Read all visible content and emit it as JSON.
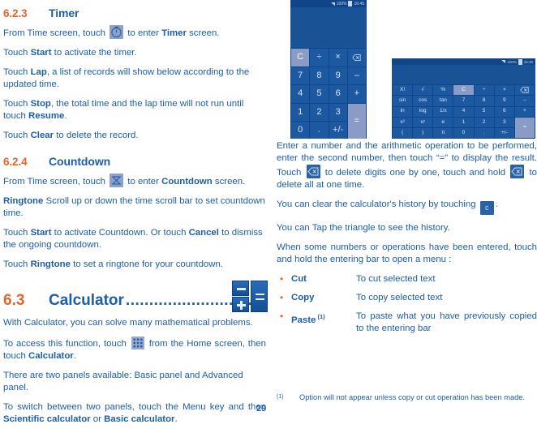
{
  "document": {
    "page_number": "29"
  },
  "sections": {
    "timer": {
      "number": "6.2.3",
      "title": "Timer",
      "paragraphs": [
        {
          "parts": [
            {
              "t": "text",
              "v": "From Time screen, touch "
            },
            {
              "t": "icon",
              "v": "timer-icon"
            },
            {
              "t": "text",
              "v": " to enter "
            },
            {
              "t": "bold",
              "v": "Timer"
            },
            {
              "t": "text",
              "v": " screen."
            }
          ]
        },
        {
          "parts": [
            {
              "t": "text",
              "v": "Touch "
            },
            {
              "t": "bold",
              "v": "Start"
            },
            {
              "t": "text",
              "v": " to activate the timer."
            }
          ]
        },
        {
          "parts": [
            {
              "t": "text",
              "v": "Touch "
            },
            {
              "t": "bold",
              "v": "Lap"
            },
            {
              "t": "text",
              "v": ", a list of records will show below according to the updated time."
            }
          ]
        },
        {
          "parts": [
            {
              "t": "text",
              "v": "Touch "
            },
            {
              "t": "bold",
              "v": "Stop"
            },
            {
              "t": "text",
              "v": ", the total time and the lap time will not run until touch "
            },
            {
              "t": "bold",
              "v": "Resume"
            },
            {
              "t": "text",
              "v": "."
            }
          ]
        },
        {
          "parts": [
            {
              "t": "text",
              "v": "Touch "
            },
            {
              "t": "bold",
              "v": "Clear"
            },
            {
              "t": "text",
              "v": " to delete the record."
            }
          ]
        }
      ]
    },
    "countdown": {
      "number": "6.2.4",
      "title": "Countdown",
      "paragraphs": [
        {
          "parts": [
            {
              "t": "text",
              "v": "From Time screen, touch "
            },
            {
              "t": "icon",
              "v": "hourglass-icon"
            },
            {
              "t": "text",
              "v": " to enter "
            },
            {
              "t": "bold",
              "v": "Countdown"
            },
            {
              "t": "text",
              "v": " screen."
            }
          ]
        },
        {
          "parts": [
            {
              "t": "bold",
              "v": "Ringtone"
            },
            {
              "t": "text",
              "v": " Scroll up or down the time scroll bar to set countdown time."
            }
          ]
        },
        {
          "parts": [
            {
              "t": "text",
              "v": "Touch "
            },
            {
              "t": "bold",
              "v": "Start"
            },
            {
              "t": "text",
              "v": " to activate Countdown. Or touch "
            },
            {
              "t": "bold",
              "v": "Cancel"
            },
            {
              "t": "text",
              "v": " to dismiss the ongoing countdown."
            }
          ]
        },
        {
          "parts": [
            {
              "t": "text",
              "v": "Touch "
            },
            {
              "t": "bold",
              "v": "Ringtone"
            },
            {
              "t": "text",
              "v": " to set a ringtone for your countdown."
            }
          ]
        }
      ]
    },
    "calculator": {
      "number": "6.3",
      "title": "Calculator",
      "dots": "...........................................",
      "paragraphs": [
        {
          "parts": [
            {
              "t": "text",
              "v": "With Calculator, you can solve many mathematical problems."
            }
          ]
        },
        {
          "justify": true,
          "parts": [
            {
              "t": "text",
              "v": "To access this function, touch "
            },
            {
              "t": "icon",
              "v": "apps-grid-icon"
            },
            {
              "t": "text",
              "v": " from the Home screen, then touch "
            },
            {
              "t": "bold",
              "v": "Calculator"
            },
            {
              "t": "text",
              "v": "."
            }
          ]
        },
        {
          "parts": [
            {
              "t": "text",
              "v": "There are two panels available: Basic panel and Advanced panel."
            }
          ]
        },
        {
          "justify": true,
          "parts": [
            {
              "t": "text",
              "v": "To switch between two panels, touch the Menu key and then "
            },
            {
              "t": "bold",
              "v": "Scientific calculator"
            },
            {
              "t": "text",
              "v": " or "
            },
            {
              "t": "bold",
              "v": "Basic calculator"
            },
            {
              "t": "text",
              "v": "."
            }
          ]
        }
      ]
    }
  },
  "right_column": {
    "paragraphs": [
      {
        "justify": true,
        "parts": [
          {
            "t": "text",
            "v": "Enter a number and the arithmetic operation to be performed, enter the second number, then touch “=” to display the result. Touch "
          },
          {
            "t": "icon",
            "v": "backspace-icon"
          },
          {
            "t": "text",
            "v": " to delete digits one by one, touch and hold "
          },
          {
            "t": "icon",
            "v": "backspace-icon"
          },
          {
            "t": "text",
            "v": " to delete all at one time."
          }
        ]
      },
      {
        "parts": [
          {
            "t": "text",
            "v": "You can clear the calculator's history by touching "
          },
          {
            "t": "icon",
            "v": "clear-c-icon"
          },
          {
            "t": "text",
            "v": "."
          }
        ]
      },
      {
        "parts": [
          {
            "t": "text",
            "v": "You can Tap the triangle to see the history."
          }
        ]
      },
      {
        "justify": true,
        "parts": [
          {
            "t": "text",
            "v": "When some numbers or operations have been entered, touch and hold the entering bar to open a menu :"
          }
        ]
      }
    ],
    "bullets": [
      {
        "term": "Cut",
        "note": "",
        "desc": "To cut selected text"
      },
      {
        "term": "Copy",
        "note": "",
        "desc": "To copy selected text"
      },
      {
        "term": "Paste",
        "note": "(1)",
        "desc": "To paste what you have previously copied to the entering bar"
      }
    ]
  },
  "footnote": {
    "mark": "(1)",
    "text": "Option will not appear unless copy or cut operation has been made."
  },
  "basic_calculator": {
    "status": {
      "signal": "",
      "battery": "100%",
      "time": "16:46"
    },
    "keys": [
      {
        "label": "C",
        "name": "key-clear",
        "style": "hl"
      },
      {
        "label": "÷",
        "name": "key-divide",
        "style": ""
      },
      {
        "label": "×",
        "name": "key-multiply",
        "style": ""
      },
      {
        "label": "⌫",
        "name": "key-backspace",
        "style": ""
      },
      {
        "label": "7",
        "name": "key-7",
        "style": ""
      },
      {
        "label": "8",
        "name": "key-8",
        "style": ""
      },
      {
        "label": "9",
        "name": "key-9",
        "style": ""
      },
      {
        "label": "–",
        "name": "key-minus",
        "style": ""
      },
      {
        "label": "4",
        "name": "key-4",
        "style": ""
      },
      {
        "label": "5",
        "name": "key-5",
        "style": ""
      },
      {
        "label": "6",
        "name": "key-6",
        "style": ""
      },
      {
        "label": "+",
        "name": "key-plus",
        "style": ""
      },
      {
        "label": "1",
        "name": "key-1",
        "style": ""
      },
      {
        "label": "2",
        "name": "key-2",
        "style": ""
      },
      {
        "label": "3",
        "name": "key-3",
        "style": ""
      },
      {
        "label": "=",
        "name": "key-equals",
        "style": "hl eq-span"
      },
      {
        "label": "0",
        "name": "key-0",
        "style": ""
      },
      {
        "label": ".",
        "name": "key-decimal",
        "style": ""
      },
      {
        "label": "+/-",
        "name": "key-sign",
        "style": ""
      }
    ]
  },
  "scientific_calculator": {
    "status": {
      "signal": "",
      "battery": "100%",
      "time": "16:46"
    },
    "keys": [
      {
        "label": "X!",
        "name": "key-factorial",
        "style": ""
      },
      {
        "label": "√",
        "name": "key-sqrt",
        "style": ""
      },
      {
        "label": "%",
        "name": "key-percent",
        "style": ""
      },
      {
        "label": "C",
        "name": "key-clear",
        "style": "hl"
      },
      {
        "label": "÷",
        "name": "key-divide",
        "style": ""
      },
      {
        "label": "×",
        "name": "key-multiply",
        "style": ""
      },
      {
        "label": "⌫",
        "name": "key-backspace",
        "style": ""
      },
      {
        "label": "sin",
        "name": "key-sin",
        "style": ""
      },
      {
        "label": "cos",
        "name": "key-cos",
        "style": ""
      },
      {
        "label": "tan",
        "name": "key-tan",
        "style": ""
      },
      {
        "label": "7",
        "name": "key-7",
        "style": ""
      },
      {
        "label": "8",
        "name": "key-8",
        "style": ""
      },
      {
        "label": "9",
        "name": "key-9",
        "style": ""
      },
      {
        "label": "–",
        "name": "key-minus",
        "style": ""
      },
      {
        "label": "ln",
        "name": "key-ln",
        "style": ""
      },
      {
        "label": "log",
        "name": "key-log",
        "style": ""
      },
      {
        "label": "1/x",
        "name": "key-reciprocal",
        "style": ""
      },
      {
        "label": "4",
        "name": "key-4",
        "style": ""
      },
      {
        "label": "5",
        "name": "key-5",
        "style": ""
      },
      {
        "label": "6",
        "name": "key-6",
        "style": ""
      },
      {
        "label": "+",
        "name": "key-plus",
        "style": ""
      },
      {
        "label": "x²",
        "name": "key-square",
        "style": ""
      },
      {
        "label": "xʸ",
        "name": "key-power",
        "style": ""
      },
      {
        "label": "e",
        "name": "key-e",
        "style": ""
      },
      {
        "label": "1",
        "name": "key-1",
        "style": ""
      },
      {
        "label": "2",
        "name": "key-2",
        "style": ""
      },
      {
        "label": "3",
        "name": "key-3",
        "style": ""
      },
      {
        "label": "=",
        "name": "key-equals",
        "style": "hl eq-span"
      },
      {
        "label": "(",
        "name": "key-paren-open",
        "style": ""
      },
      {
        "label": ")",
        "name": "key-paren-close",
        "style": ""
      },
      {
        "label": "π",
        "name": "key-pi",
        "style": ""
      },
      {
        "label": "0",
        "name": "key-0",
        "style": ""
      },
      {
        "label": ".",
        "name": "key-decimal",
        "style": ""
      },
      {
        "label": "+/-",
        "name": "key-sign",
        "style": ""
      }
    ]
  },
  "colors": {
    "heading_orange": "#e8632a",
    "body_blue": "#1c5ea8",
    "phone_blue": "#1c5396",
    "key_blue": "#1d59a0",
    "key_highlight": "#8a9cc6"
  }
}
